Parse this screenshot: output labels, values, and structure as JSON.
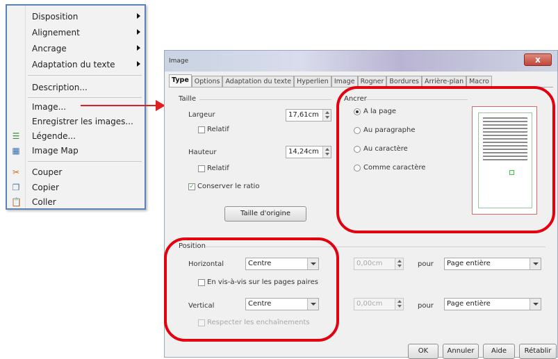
{
  "context_menu": {
    "items": [
      {
        "label": "Disposition",
        "submenu": true
      },
      {
        "label": "Alignement",
        "submenu": true
      },
      {
        "label": "Ancrage",
        "submenu": true
      },
      {
        "label": "Adaptation du texte",
        "submenu": true
      },
      {
        "label": "Description..."
      },
      {
        "label": "Image..."
      },
      {
        "label": "Enregistrer les images..."
      },
      {
        "label": "Légende..."
      },
      {
        "label": "Image Map"
      },
      {
        "label": "Couper"
      },
      {
        "label": "Copier"
      },
      {
        "label": "Coller"
      }
    ]
  },
  "dialog": {
    "title": "Image",
    "close_label": "x",
    "tabs": [
      "Type",
      "Options",
      "Adaptation du texte",
      "Hyperlien",
      "Image",
      "Rogner",
      "Bordures",
      "Arrière-plan",
      "Macro"
    ],
    "active_tab": "Type",
    "taille": {
      "label": "Taille",
      "largeur_label": "Largeur",
      "largeur_value": "17,61cm",
      "largeur_relatif": "Relatif",
      "hauteur_label": "Hauteur",
      "hauteur_value": "14,24cm",
      "hauteur_relatif": "Relatif",
      "conserver_ratio": "Conserver le ratio",
      "taille_origine": "Taille d'origine"
    },
    "ancrer": {
      "label": "Ancrer",
      "options": [
        "A la page",
        "Au paragraphe",
        "Au caractère",
        "Comme caractère"
      ],
      "selected": "A la page"
    },
    "position": {
      "label": "Position",
      "horizontal_label": "Horizontal",
      "horizontal_value": "Centre",
      "horizontal_offset": "0,00cm",
      "horizontal_pour": "pour",
      "horizontal_ref": "Page entière",
      "mirror_label": "En vis-à-vis sur les pages paires",
      "vertical_label": "Vertical",
      "vertical_value": "Centre",
      "vertical_offset": "0,00cm",
      "vertical_pour": "pour",
      "vertical_ref": "Page entière",
      "respecter_label": "Respecter les enchaînements"
    },
    "buttons": {
      "ok": "OK",
      "annuler": "Annuler",
      "aide": "Aide",
      "retablir": "Rétablir"
    }
  },
  "colors": {
    "highlight": "#e3000f",
    "arrow": "#e02020",
    "menu_border": "#5b7fb7"
  }
}
